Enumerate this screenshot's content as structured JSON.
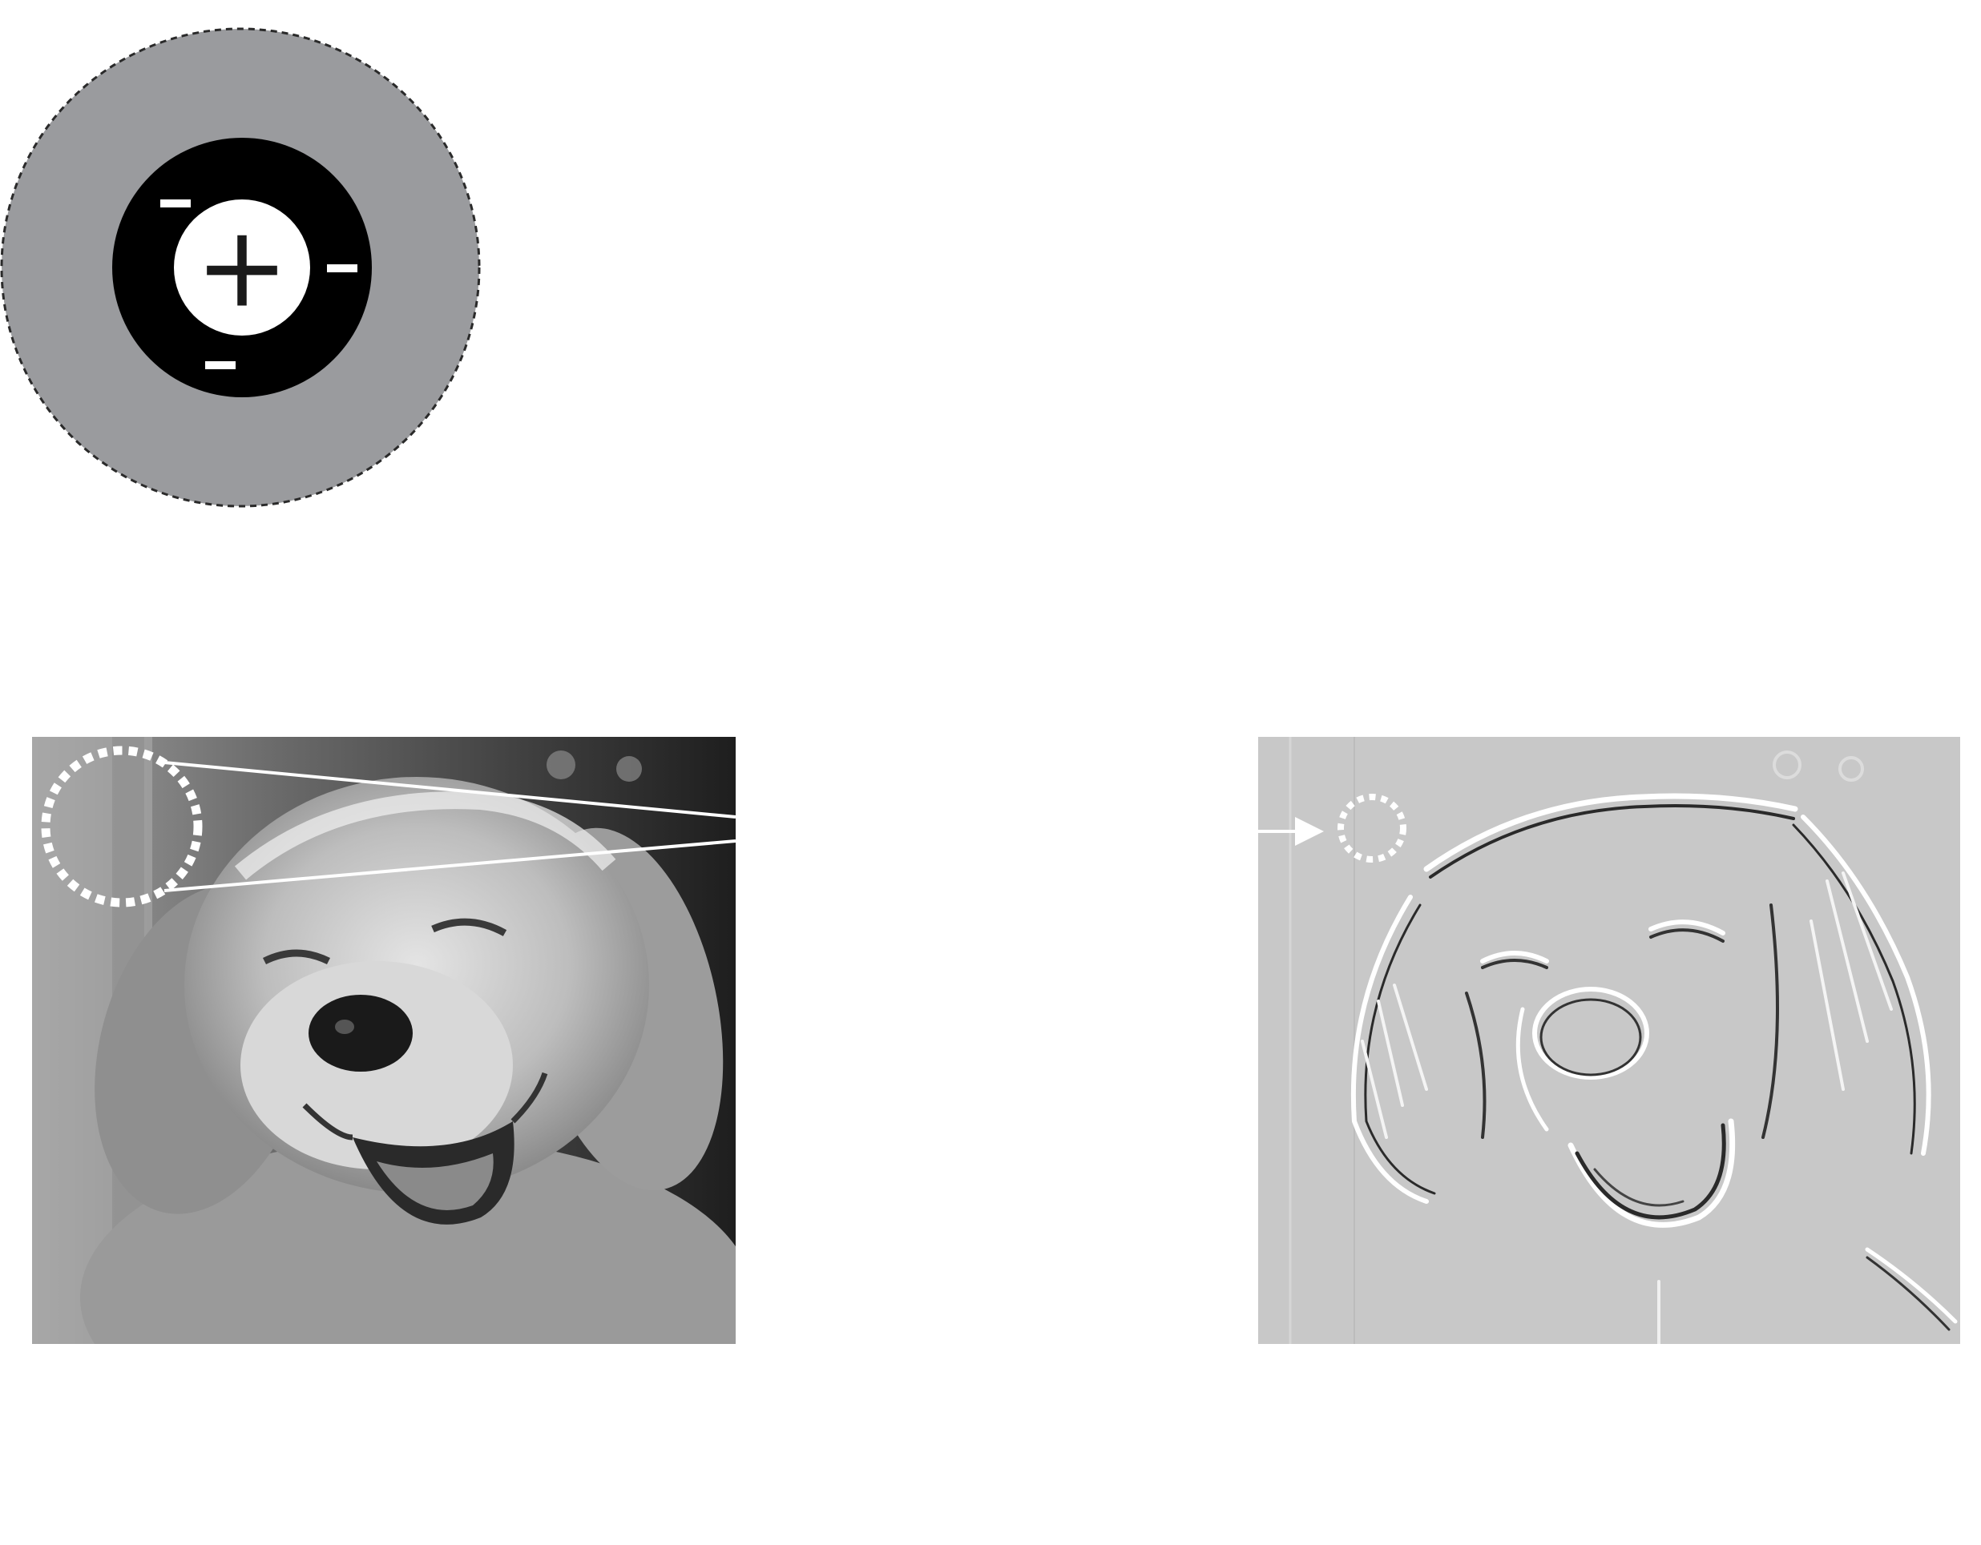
{
  "receptive_field": {
    "center_sign": "+",
    "surround_signs": [
      "−",
      "−",
      "−"
    ],
    "colors": {
      "outer_disc": "#9a9b9e",
      "surround_ring": "#000000",
      "center": "#ffffff",
      "center_sign": "#1a1a1a",
      "surround_sign": "#ffffff"
    }
  },
  "input_photo": {
    "subject": "dog-face",
    "tone": "grayscale",
    "colors": {
      "dark": "#1c1c1c",
      "mid": "#7a7a7a",
      "fur": "#c9c9c9",
      "highlight": "#ececec"
    }
  },
  "output_photo": {
    "subject": "dog-face-edge-map",
    "tone": "grayscale",
    "colors": {
      "background": "#c8c8c8",
      "light_edge": "#ffffff",
      "dark_edge": "#2a2a2a"
    }
  },
  "marker_color": "#ffffff"
}
